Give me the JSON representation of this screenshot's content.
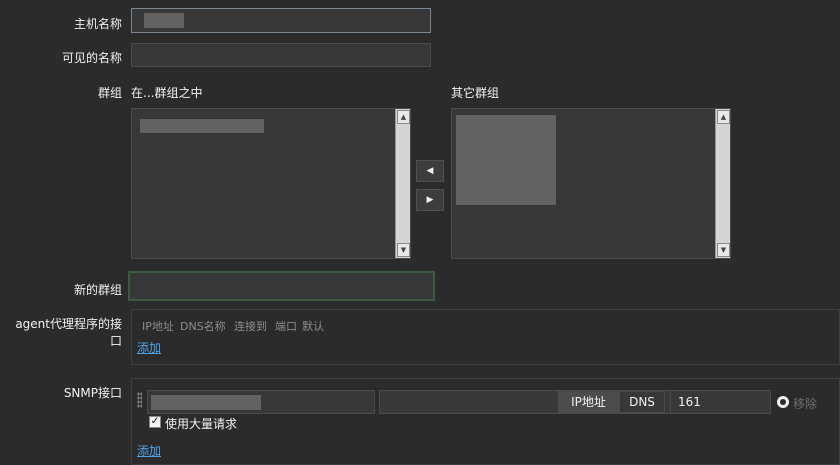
{
  "fields": {
    "host_name_label": "主机名称",
    "visible_name_label": "可见的名称",
    "groups_label": "群组",
    "in_groups_header": "在...群组之中",
    "other_groups_header": "其它群组",
    "new_group_label": "新的群组",
    "agent_interface_label": "agent代理程序的接口",
    "snmp_interface_label": "SNMP接口"
  },
  "move_buttons": {
    "left": "◀",
    "right": "▶"
  },
  "agent_panel": {
    "columns": [
      "IP地址",
      "DNS名称",
      "连接到",
      "端口",
      "默认"
    ],
    "add_link": "添加"
  },
  "snmp_panel": {
    "port_value": "161",
    "connect_options": [
      "IP地址",
      "DNS"
    ],
    "selected_connect": "IP地址",
    "remove_label": "移除",
    "bulk_checkbox_label": "使用大量请求",
    "bulk_checked": true,
    "add_link": "添加"
  },
  "scroll_arrows": {
    "up": "▲",
    "down": "▼"
  }
}
